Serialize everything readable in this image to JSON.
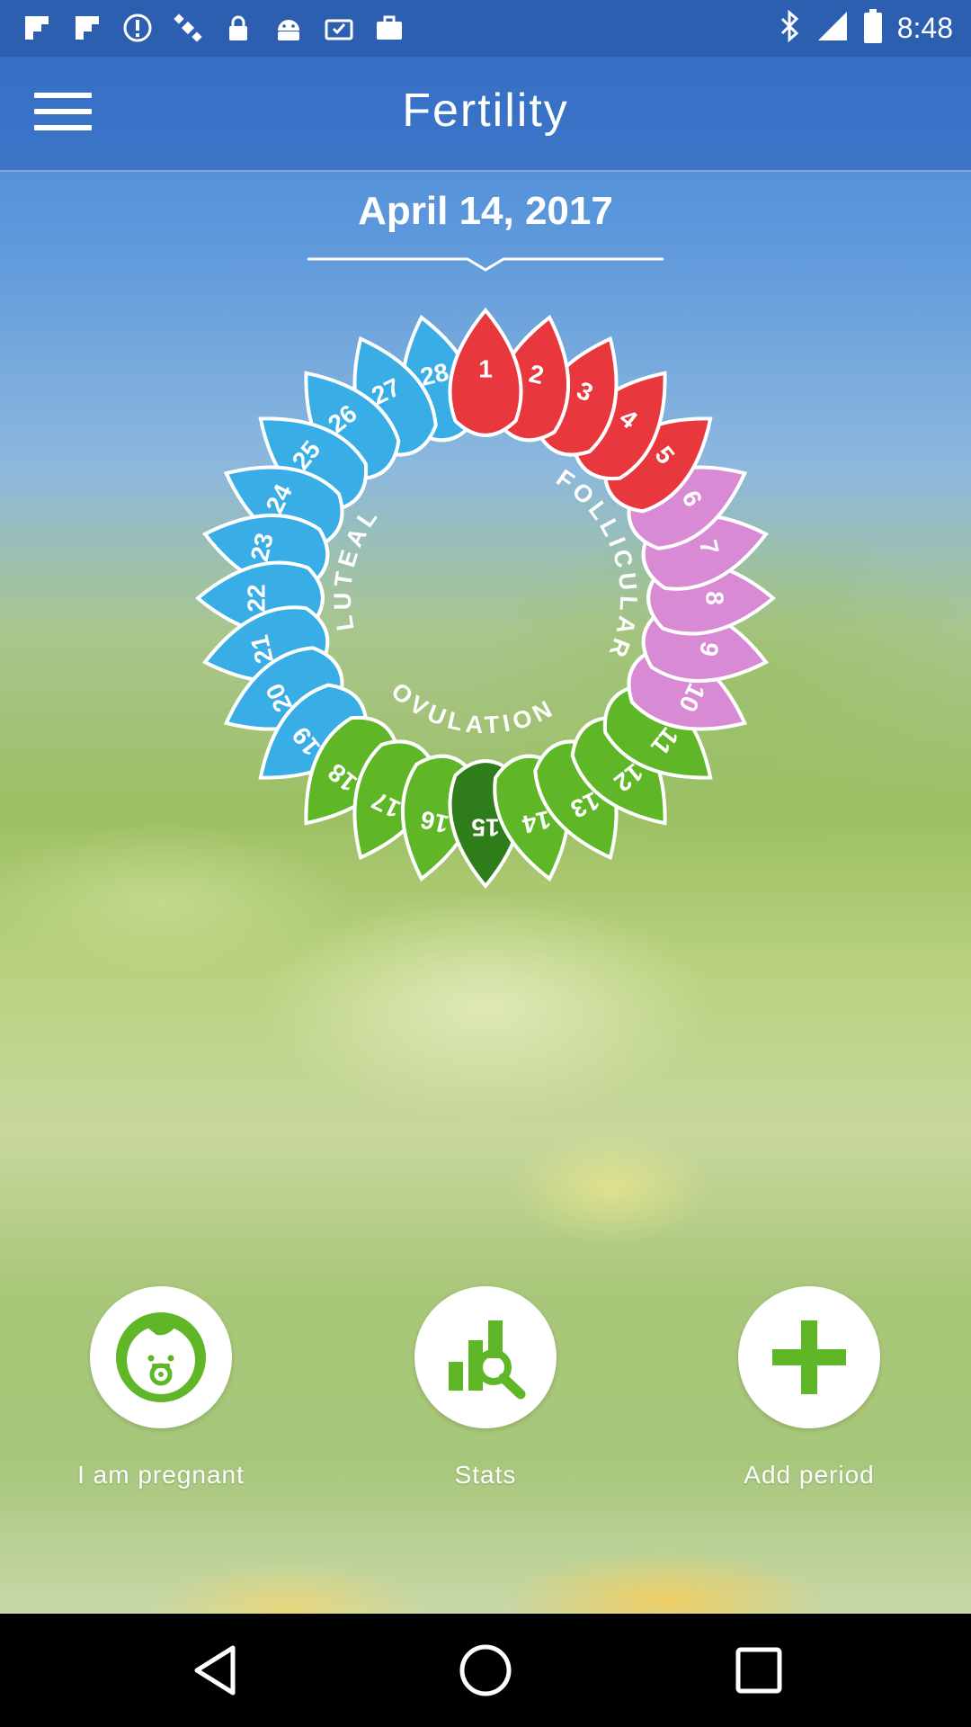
{
  "status_bar": {
    "time": "8:48",
    "icons": [
      "notification-flipboard-icon",
      "notification-flipboard-icon",
      "alert-icon",
      "satellite-icon",
      "lock-icon",
      "android-icon",
      "calendar-check-icon",
      "briefcase-icon",
      "bluetooth-icon",
      "signal-icon",
      "battery-icon"
    ]
  },
  "app_bar": {
    "title": "Fertility",
    "menu_icon": "hamburger-menu-icon"
  },
  "date_selector": {
    "value": "April 14, 2017"
  },
  "cycle": {
    "current_day": 15,
    "phases": {
      "follicular": "FOLLICULAR",
      "ovulation": "OVULATION",
      "luteal": "LUTEAL"
    },
    "days": [
      {
        "day": "1",
        "phase": "period"
      },
      {
        "day": "2",
        "phase": "period"
      },
      {
        "day": "3",
        "phase": "period"
      },
      {
        "day": "4",
        "phase": "period"
      },
      {
        "day": "5",
        "phase": "period"
      },
      {
        "day": "6",
        "phase": "follicular"
      },
      {
        "day": "7",
        "phase": "follicular"
      },
      {
        "day": "8",
        "phase": "follicular"
      },
      {
        "day": "9",
        "phase": "follicular"
      },
      {
        "day": "10",
        "phase": "follicular"
      },
      {
        "day": "11",
        "phase": "ovulation"
      },
      {
        "day": "12",
        "phase": "ovulation"
      },
      {
        "day": "13",
        "phase": "ovulation"
      },
      {
        "day": "14",
        "phase": "ovulation"
      },
      {
        "day": "15",
        "phase": "ovulation-peak"
      },
      {
        "day": "16",
        "phase": "ovulation"
      },
      {
        "day": "17",
        "phase": "ovulation"
      },
      {
        "day": "18",
        "phase": "ovulation"
      },
      {
        "day": "19",
        "phase": "luteal"
      },
      {
        "day": "20",
        "phase": "luteal"
      },
      {
        "day": "21",
        "phase": "luteal"
      },
      {
        "day": "22",
        "phase": "luteal"
      },
      {
        "day": "23",
        "phase": "luteal"
      },
      {
        "day": "24",
        "phase": "luteal"
      },
      {
        "day": "25",
        "phase": "luteal"
      },
      {
        "day": "26",
        "phase": "luteal"
      },
      {
        "day": "27",
        "phase": "luteal"
      },
      {
        "day": "28",
        "phase": "luteal"
      }
    ],
    "colors": {
      "period": "#e8383e",
      "follicular": "#d98ad4",
      "ovulation": "#5fb626",
      "ovulation-peak": "#2e7d1a",
      "luteal": "#38ade6"
    }
  },
  "actions": [
    {
      "label": "I am pregnant",
      "icon": "baby-icon"
    },
    {
      "label": "Stats",
      "icon": "stats-search-icon"
    },
    {
      "label": "Add period",
      "icon": "plus-icon"
    }
  ],
  "theme": {
    "accent_green": "#5fb626",
    "header_blue": "#2c5fb0"
  },
  "nav_bar": {
    "buttons": [
      "back-icon",
      "home-icon",
      "recents-icon"
    ]
  }
}
